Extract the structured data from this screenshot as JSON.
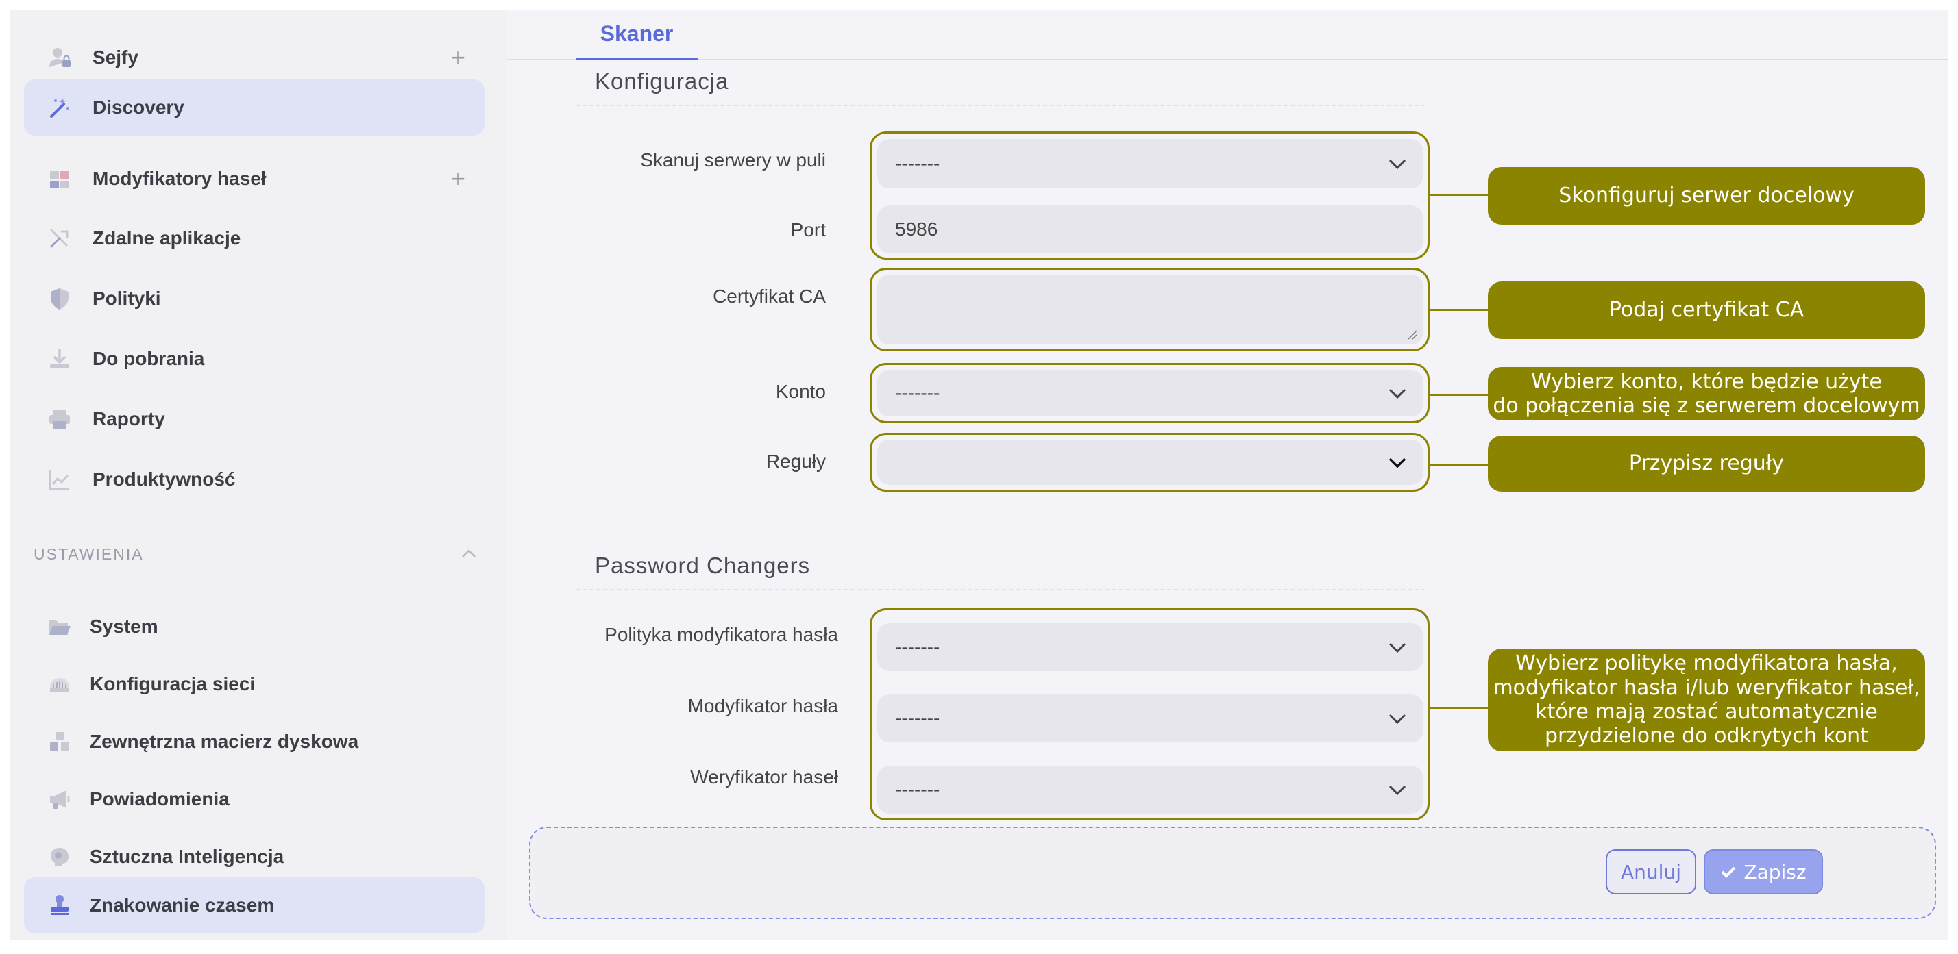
{
  "sidebar": {
    "items": [
      {
        "label": "Sejfy",
        "icon": "user-lock-icon",
        "has_add": true,
        "active": false
      },
      {
        "label": "Discovery",
        "icon": "magic-wand-icon",
        "has_add": false,
        "active": true
      },
      {
        "label": "Modyfikatory haseł",
        "icon": "puzzle-icon",
        "has_add": true,
        "active": false
      },
      {
        "label": "Zdalne aplikacje",
        "icon": "remote-apps-icon",
        "has_add": false,
        "active": false
      },
      {
        "label": "Polityki",
        "icon": "shield-icon",
        "has_add": false,
        "active": false
      },
      {
        "label": "Do pobrania",
        "icon": "download-icon",
        "has_add": false,
        "active": false
      },
      {
        "label": "Raporty",
        "icon": "printer-icon",
        "has_add": false,
        "active": false
      },
      {
        "label": "Produktywność",
        "icon": "trend-chart-icon",
        "has_add": false,
        "active": false
      }
    ],
    "add_symbol": "+",
    "settings_header": "USTAWIENIA",
    "settings_items": [
      {
        "label": "System",
        "icon": "folder-open-icon",
        "active": false
      },
      {
        "label": "Konfiguracja sieci",
        "icon": "network-icon",
        "active": false
      },
      {
        "label": "Zewnętrzna macierz dyskowa",
        "icon": "storage-boxes-icon",
        "active": false
      },
      {
        "label": "Powiadomienia",
        "icon": "megaphone-icon",
        "active": false
      },
      {
        "label": "Sztuczna Inteligencja",
        "icon": "brain-icon",
        "active": false
      },
      {
        "label": "Znakowanie czasem",
        "icon": "stamp-icon",
        "active": true
      }
    ]
  },
  "main": {
    "tab": "Skaner",
    "konfiguracja": {
      "title": "Konfiguracja",
      "fields": {
        "skanuj_label": "Skanuj serwery w puli",
        "skanuj_value": "-------",
        "port_label": "Port",
        "port_value": "5986",
        "cert_label": "Certyfikat CA",
        "cert_value": "",
        "konto_label": "Konto",
        "konto_value": "-------",
        "reguly_label": "Reguły",
        "reguly_value": ""
      }
    },
    "password_changers": {
      "title": "Password Changers",
      "fields": {
        "polityka_label": "Polityka modyfikatora hasła",
        "polityka_value": "-------",
        "modyfikator_label": "Modyfikator hasła",
        "modyfikator_value": "-------",
        "weryfikator_label": "Weryfikator haseł",
        "weryfikator_value": "-------"
      }
    },
    "callouts": {
      "target_server": "Skonfiguruj serwer docelowy",
      "ca_cert": "Podaj certyfikat CA",
      "account_line1": "Wybierz konto, które będzie użyte",
      "account_line2": "do połączenia się z serwerem docelowym",
      "rules": "Przypisz reguły",
      "changers_line1": "Wybierz politykę modyfikatora hasła,",
      "changers_line2": "modyfikator hasła i/lub weryfikator haseł,",
      "changers_line3": "które mają zostać automatycznie",
      "changers_line4": "przydzielone do odkrytych kont"
    },
    "buttons": {
      "cancel": "Anuluj",
      "save": "Zapisz",
      "save_icon": "check-icon"
    }
  },
  "colors": {
    "accent": "#5a6ad8",
    "callout": "#8a8400",
    "active_nav": "#e0e2f6"
  }
}
